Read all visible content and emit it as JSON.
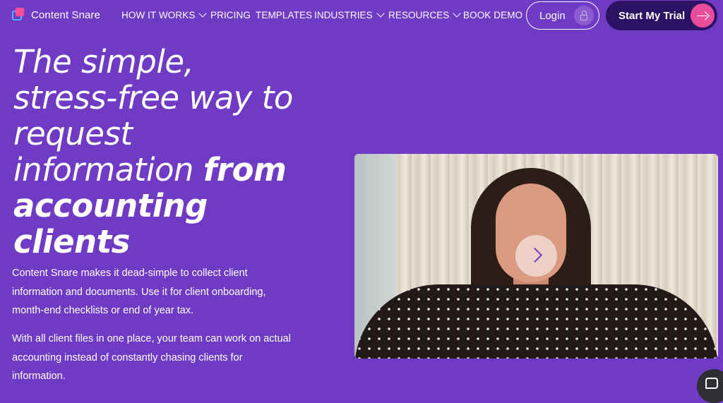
{
  "brand": {
    "name": "Content Snare"
  },
  "nav": {
    "items": [
      {
        "label": "HOW IT WORKS",
        "has_dropdown": true
      },
      {
        "label": "PRICING",
        "has_dropdown": false
      },
      {
        "label": "TEMPLATES",
        "has_dropdown": false
      },
      {
        "label": "INDUSTRIES",
        "has_dropdown": true
      },
      {
        "label": "RESOURCES",
        "has_dropdown": true
      },
      {
        "label": "BOOK DEMO",
        "has_dropdown": false
      }
    ],
    "login_label": "Login",
    "trial_label": "Start My Trial"
  },
  "hero": {
    "headline_lines": [
      {
        "regular": "The simple,",
        "bold": ""
      },
      {
        "regular": "stress-free way to",
        "bold": ""
      },
      {
        "regular": "request",
        "bold": ""
      },
      {
        "regular": "information ",
        "bold": "from"
      },
      {
        "regular": "",
        "bold": "accounting"
      },
      {
        "regular": "",
        "bold": "clients"
      }
    ],
    "paragraph_1": "Content Snare makes it dead-simple to collect client information and documents. Use it for client onboarding, month-end checklists or end of year tax.",
    "paragraph_2": "With all client files in one place, your team can work on actual accounting instead of constantly chasing clients for information."
  },
  "video": {
    "state": "paused"
  },
  "colors": {
    "background": "#6f3bc4",
    "trial_button": "#2b1262",
    "accent_pink": "#e84c9a"
  },
  "icons": [
    "lock-icon",
    "arrow-right-icon",
    "play-icon",
    "chat-icon",
    "chevron-down-icon"
  ]
}
